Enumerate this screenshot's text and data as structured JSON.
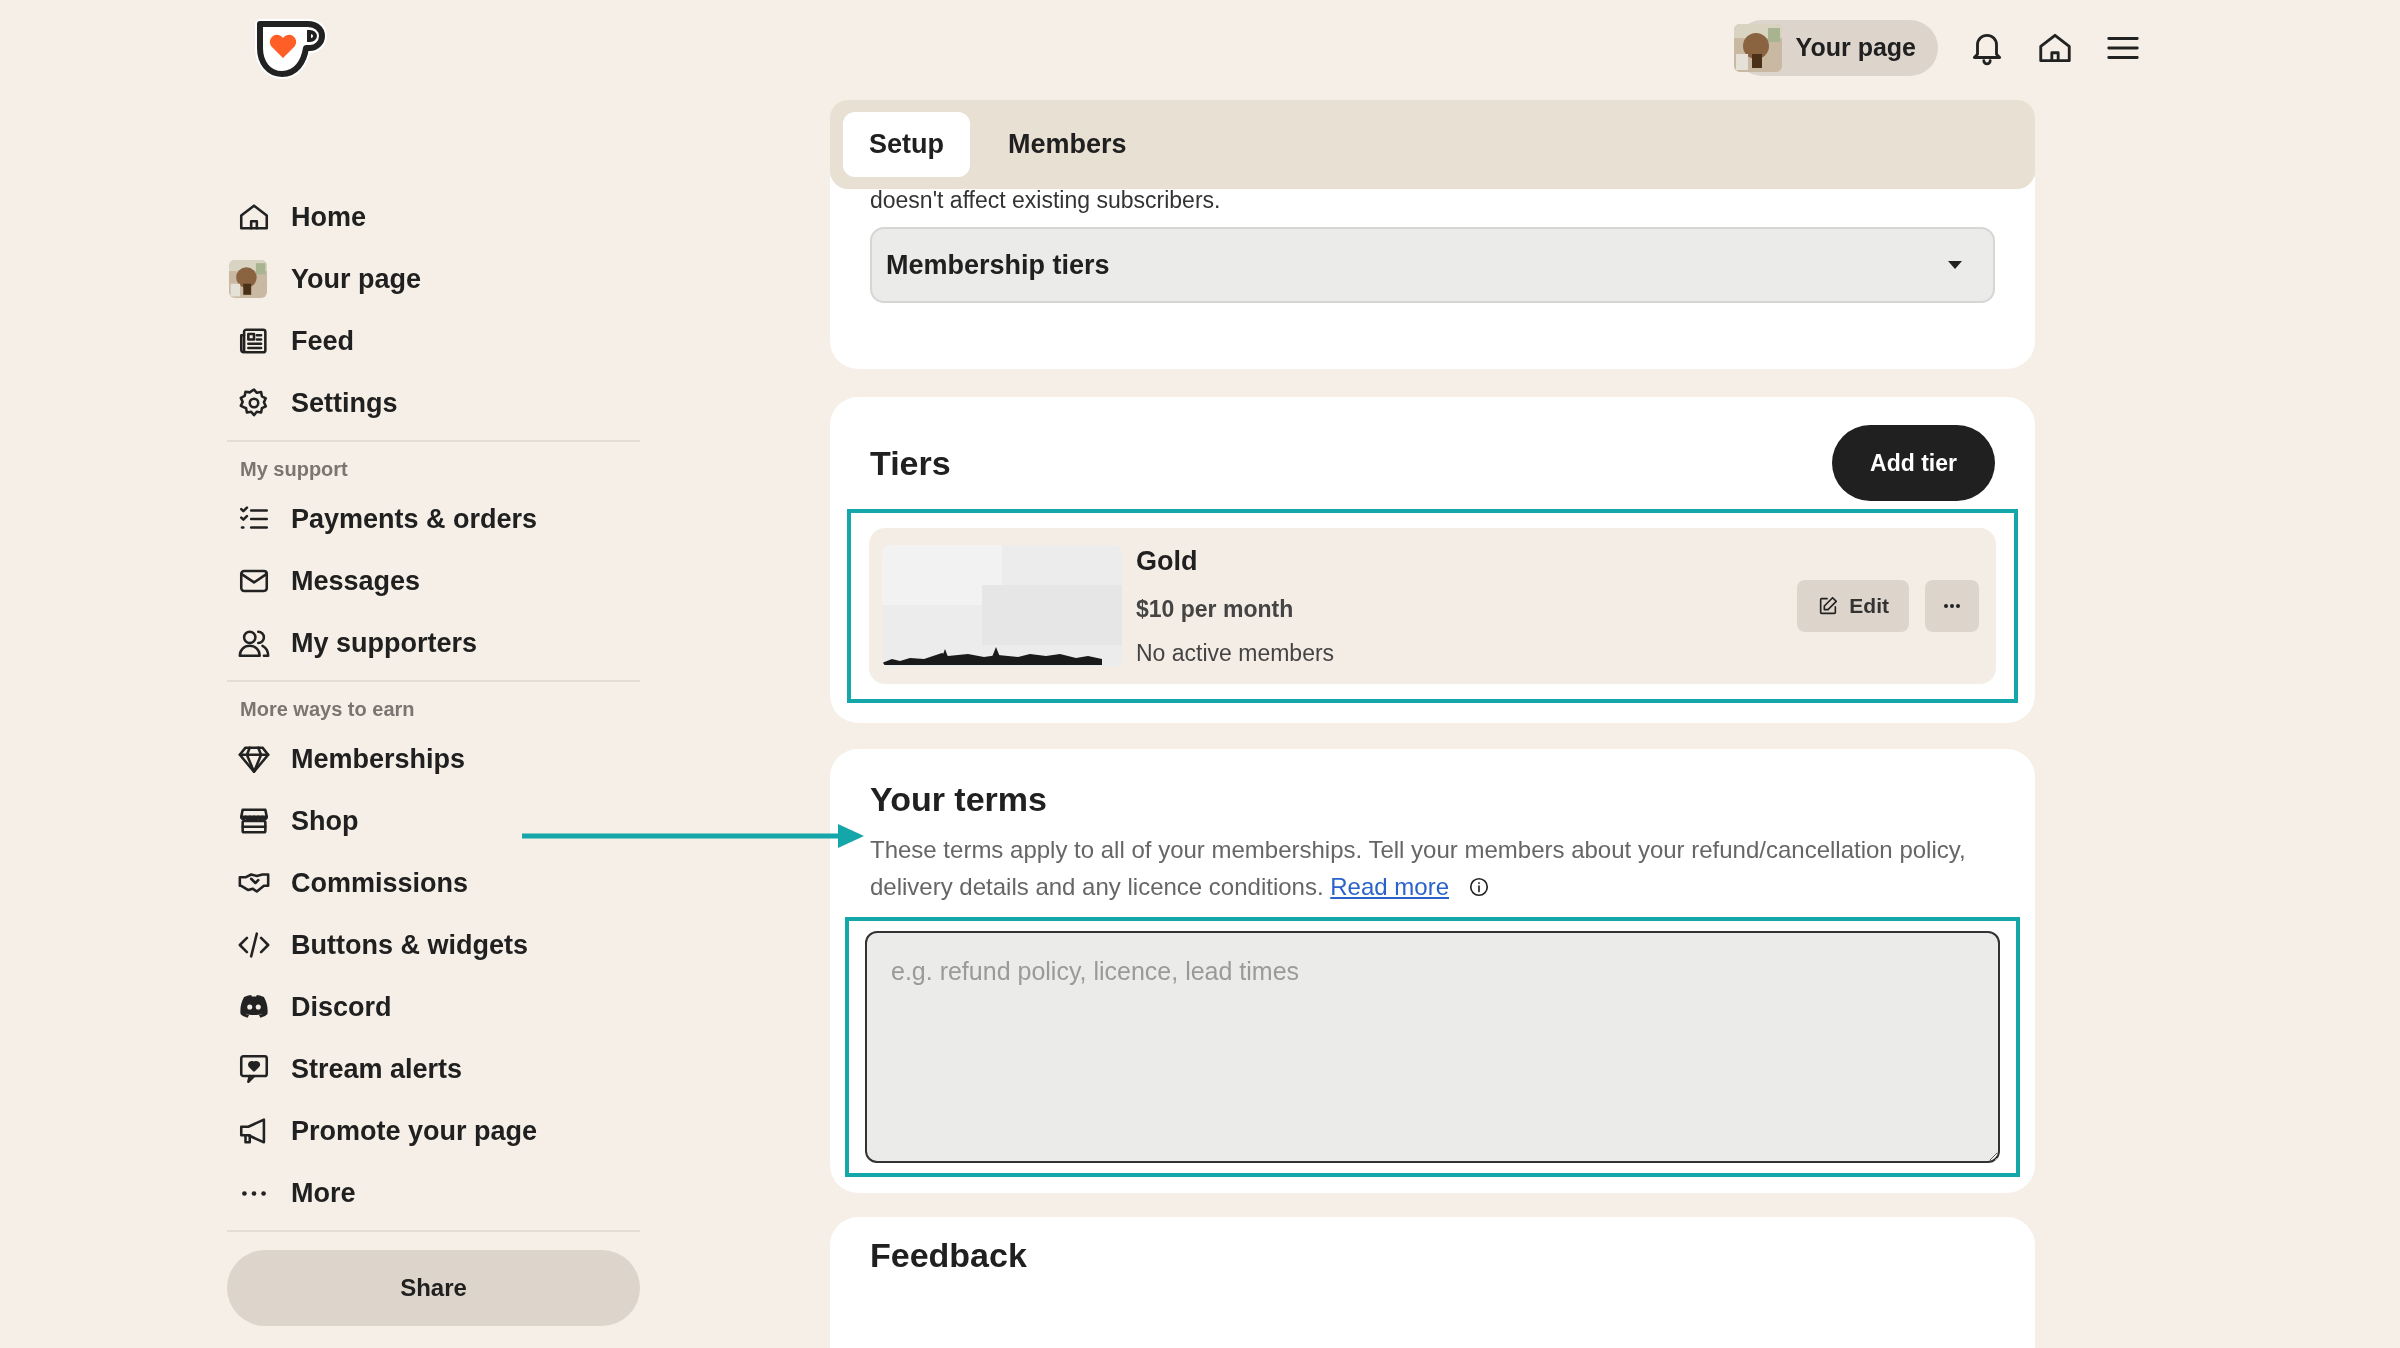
{
  "top_bar": {
    "profile_button": "Your page"
  },
  "sidebar": {
    "sections": [
      {
        "items": [
          {
            "label": "Home"
          },
          {
            "label": "Your page"
          },
          {
            "label": "Feed"
          },
          {
            "label": "Settings"
          }
        ]
      },
      {
        "heading": "My support",
        "items": [
          {
            "label": "Payments & orders"
          },
          {
            "label": "Messages"
          },
          {
            "label": "My supporters"
          }
        ]
      },
      {
        "heading": "More ways to earn",
        "items": [
          {
            "label": "Memberships"
          },
          {
            "label": "Shop"
          },
          {
            "label": "Commissions"
          },
          {
            "label": "Buttons & widgets"
          },
          {
            "label": "Discord"
          },
          {
            "label": "Stream alerts"
          },
          {
            "label": "Promote your page"
          },
          {
            "label": "More"
          }
        ]
      }
    ],
    "share_button": "Share"
  },
  "tabs": [
    {
      "label": "Setup",
      "selected": true
    },
    {
      "label": "Members",
      "selected": false
    }
  ],
  "settings_card": {
    "partial_text": "doesn't affect existing subscribers.",
    "dropdown": "Membership tiers"
  },
  "tiers": {
    "title": "Tiers",
    "add_button": "Add tier",
    "items": [
      {
        "name": "Gold",
        "price": "$10 per month",
        "members": "No active members",
        "edit_button": "Edit"
      }
    ]
  },
  "terms": {
    "title": "Your terms",
    "description": "These terms apply to all of your memberships. Tell your members about your refund/cancellation policy, delivery details and any licence conditions.",
    "link": "Read more",
    "placeholder": "e.g. refund policy, licence, lead times"
  },
  "feedback": {
    "title": "Feedback"
  }
}
